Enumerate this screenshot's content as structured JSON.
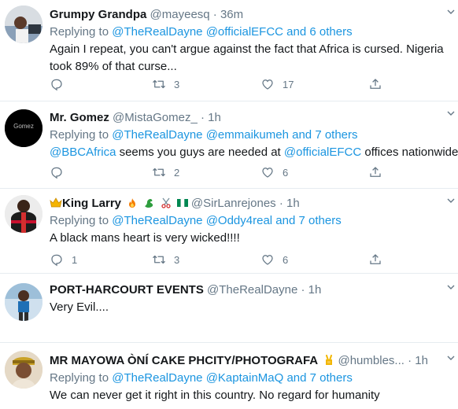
{
  "tweets": [
    {
      "name": "Grumpy Grandpa",
      "handle": "@mayeesq",
      "time": "· 36m",
      "replying_prefix": "Replying to ",
      "mentions": [
        "@TheRealDayne",
        "@officialEFCC"
      ],
      "others": "and 6 others",
      "text": "Again I repeat, you can't argue against the fact that Africa is cursed. Nigeria took 89% of that curse...",
      "counts": {
        "reply": "",
        "retweet": "3",
        "like": "17"
      }
    },
    {
      "name": "Mr. Gomez",
      "handle": "@MistaGomez_",
      "time": "· 1h",
      "avatar_text": "Gomez",
      "replying_prefix": "Replying to ",
      "mentions": [
        "@TheRealDayne",
        "@emmaikumeh"
      ],
      "others": "and 7 others",
      "text_parts": [
        "@BBCAfrica",
        " seems you guys are needed at ",
        "@officialEFCC",
        " offices nationwide"
      ],
      "counts": {
        "reply": "",
        "retweet": "2",
        "like": "6"
      }
    },
    {
      "name": "King Larry",
      "handle": "@SirLanrejones",
      "time": "· 1h",
      "replying_prefix": "Replying to ",
      "mentions": [
        "@TheRealDayne",
        "@Oddy4real"
      ],
      "others": "and 7 others",
      "text": "A black mans heart is very wicked!!!!",
      "counts": {
        "reply": "1",
        "retweet": "3",
        "like": "6"
      }
    },
    {
      "name": "PORT-HARCOURT EVENTS",
      "handle": "@TheRealDayne",
      "time": "· 1h",
      "text": "Very Evil...."
    },
    {
      "name": "MR MAYOWA ÒNÍ CAKE PHCITY/PHOTOGRAFA",
      "handle": "@humbles...",
      "time": "· 1h",
      "replying_prefix": "Replying to ",
      "mentions": [
        "@TheRealDayne",
        "@KaptainMaQ"
      ],
      "others": "and 7 others",
      "text": "We can never get it right in this country. No regard for humanity"
    }
  ],
  "colors": {
    "link": "#1b95e0",
    "muted": "#657786",
    "divider": "#e6ecf0"
  },
  "icons": [
    "reply-icon",
    "retweet-icon",
    "like-icon",
    "share-icon",
    "chevron-down-icon"
  ]
}
